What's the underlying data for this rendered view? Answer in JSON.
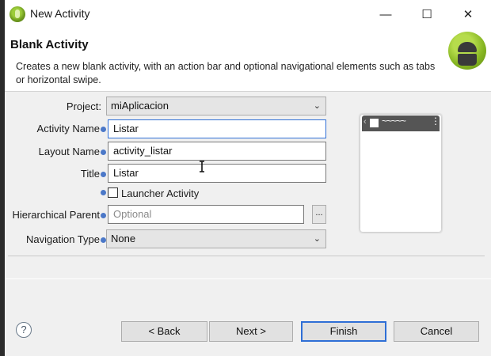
{
  "window": {
    "title": "New Activity",
    "controls": {
      "minimize": "—",
      "maximize": "☐",
      "close": "✕"
    }
  },
  "header": {
    "title": "Blank Activity",
    "description": "Creates a new blank activity, with an action bar and optional navigational elements such as tabs or horizontal swipe."
  },
  "form": {
    "project": {
      "label": "Project:",
      "value": "miAplicacion"
    },
    "activity_name": {
      "label": "Activity Name",
      "value": "Listar"
    },
    "layout_name": {
      "label": "Layout Name",
      "value": "activity_listar"
    },
    "title": {
      "label": "Title",
      "value": "Listar"
    },
    "launcher_activity": {
      "label": "Launcher Activity",
      "checked": false
    },
    "hierarchical_parent": {
      "label": "Hierarchical Parent",
      "placeholder": "Optional",
      "browse_label": "..."
    },
    "navigation_type": {
      "label": "Navigation Type",
      "value": "None"
    }
  },
  "preview": {
    "back": "‹",
    "dots": "⋮",
    "wave": "~~~~~"
  },
  "buttons": {
    "help": "?",
    "back": "< Back",
    "next": "Next >",
    "finish": "Finish",
    "cancel": "Cancel"
  },
  "colors": {
    "accent": "#2f6fd6",
    "info_icon": "#4b78c8",
    "android": "#86b522"
  }
}
